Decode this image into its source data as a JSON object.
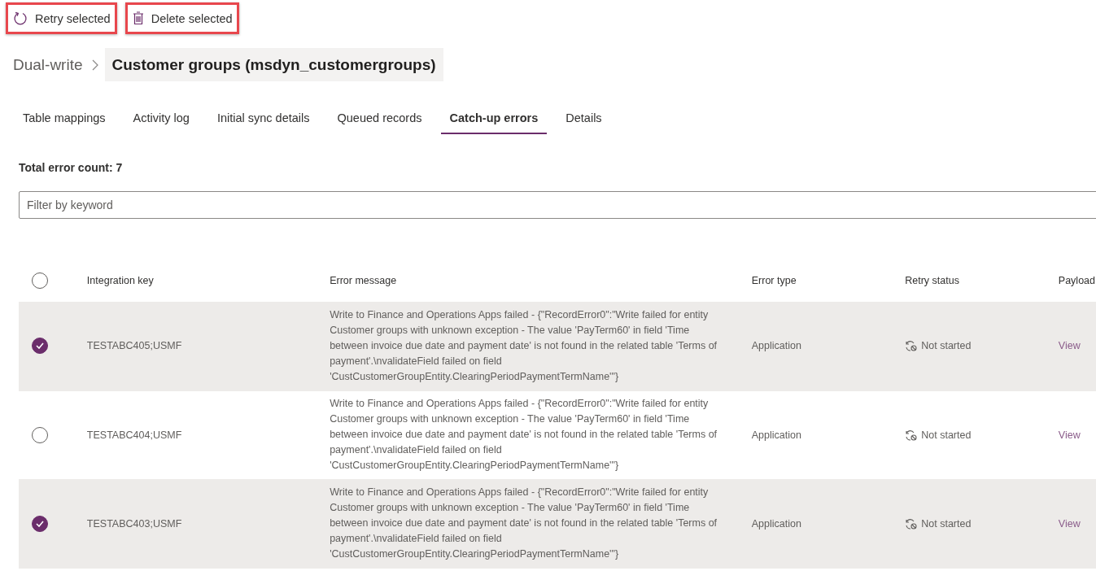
{
  "toolbar": [
    {
      "kind": "retry",
      "label": "Retry selected"
    },
    {
      "kind": "delete",
      "label": "Delete selected"
    }
  ],
  "breadcrumb": {
    "parent": "Dual-write",
    "current": "Customer groups (msdyn_customergroups)"
  },
  "tabs": [
    {
      "label": "Table mappings",
      "selected": false
    },
    {
      "label": "Activity log",
      "selected": false
    },
    {
      "label": "Initial sync details",
      "selected": false
    },
    {
      "label": "Queued records",
      "selected": false
    },
    {
      "label": "Catch-up errors",
      "selected": true
    },
    {
      "label": "Details",
      "selected": false
    }
  ],
  "total_error_count": "Total error count: 7",
  "filter": {
    "placeholder": "Filter by keyword"
  },
  "table": {
    "select_all": {
      "checked": false
    },
    "columns": [
      "Integration key",
      "Error message",
      "Error type",
      "Retry status",
      "Payload"
    ],
    "rows": [
      {
        "selected": true,
        "integration_key": "TESTABC405;USMF",
        "error_message": "Write to Finance and Operations Apps failed - {\"RecordError0\":\"Write failed for entity Customer groups with unknown exception - The value 'PayTerm60' in field 'Time between invoice due date and payment date' is not found in the related table 'Terms of payment'.\\nvalidateField failed on field 'CustCustomerGroupEntity.ClearingPeriodPaymentTermName'\"}",
        "error_type": "Application",
        "retry_status": "Not started",
        "payload": "View"
      },
      {
        "selected": false,
        "integration_key": "TESTABC404;USMF",
        "error_message": "Write to Finance and Operations Apps failed - {\"RecordError0\":\"Write failed for entity Customer groups with unknown exception - The value 'PayTerm60' in field 'Time between invoice due date and payment date' is not found in the related table 'Terms of payment'.\\nvalidateField failed on field 'CustCustomerGroupEntity.ClearingPeriodPaymentTermName'\"}",
        "error_type": "Application",
        "retry_status": "Not started",
        "payload": "View"
      },
      {
        "selected": true,
        "integration_key": "TESTABC403;USMF",
        "error_message": "Write to Finance and Operations Apps failed - {\"RecordError0\":\"Write failed for entity Customer groups with unknown exception - The value 'PayTerm60' in field 'Time between invoice due date and payment date' is not found in the related table 'Terms of payment'.\\nvalidateField failed on field 'CustCustomerGroupEntity.ClearingPeriodPaymentTermName'\"}",
        "error_type": "Application",
        "retry_status": "Not started",
        "payload": "View"
      }
    ]
  }
}
